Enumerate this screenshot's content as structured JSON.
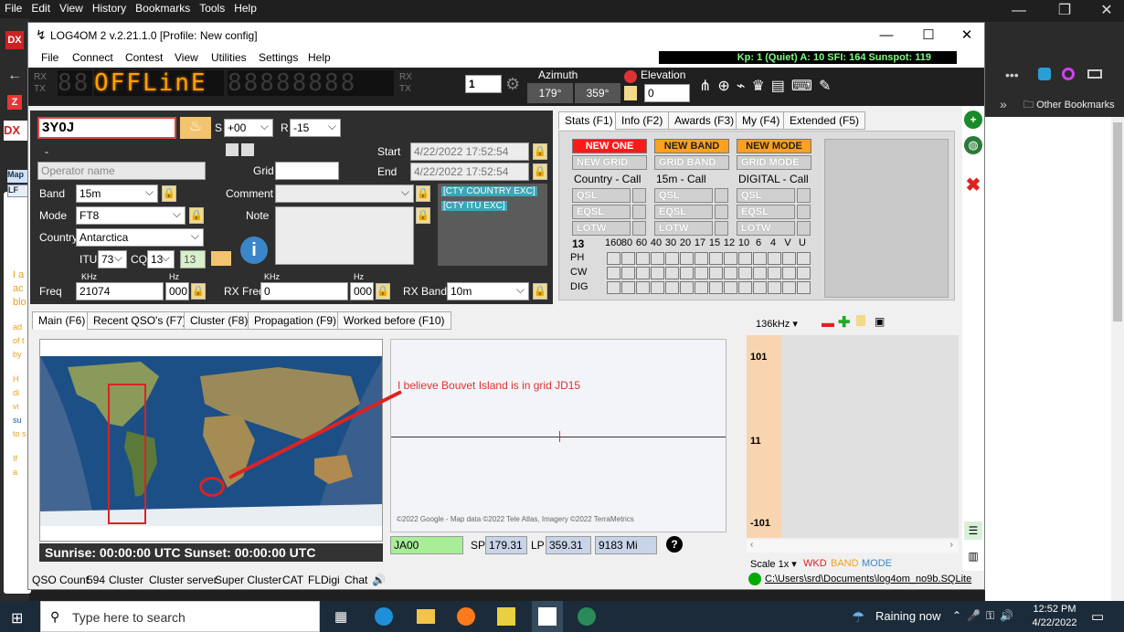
{
  "browser": {
    "menu": [
      "File",
      "Edit",
      "View",
      "History",
      "Bookmarks",
      "Tools",
      "Help"
    ],
    "other_bookmarks": "Other Bookmarks",
    "sidebar_bits": [
      "Map",
      "LF",
      "I a",
      "ac",
      "blo",
      "ad",
      "of t",
      "by",
      "H",
      "di",
      "vi",
      "su",
      "to s",
      "If",
      "a"
    ]
  },
  "app": {
    "title": "LOG4OM 2 v.2.21.1.0 [Profile: New config]",
    "menu": [
      "File",
      "Connect",
      "Contest",
      "View",
      "Utilities",
      "Settings",
      "Help"
    ],
    "kp_text": "Kp: 1 (Quiet)  A: 10  SFI: 164  Sunspot: 119",
    "display": {
      "left": "88",
      "offline": "OFFLinE",
      "right": "88888888"
    },
    "rx": "RX",
    "tx": "TX",
    "radio_num": "1",
    "azimuth": {
      "label": "Azimuth",
      "sp": "179°",
      "lp": "359°"
    },
    "elevation": {
      "label": "Elevation",
      "value": "0"
    },
    "qso": {
      "callsign": "3Y0J",
      "s_label": "S",
      "s_value": "+00",
      "r_label": "R",
      "r_value": "-15",
      "dash": "-",
      "operator_placeholder": "Operator name",
      "grid_label": "Grid",
      "grid_value": "",
      "start_label": "Start",
      "start_value": "4/22/2022 17:52:54",
      "end_label": "End",
      "end_value": "4/22/2022 17:52:54",
      "band_label": "Band",
      "band_value": "15m",
      "mode_label": "Mode",
      "mode_value": "FT8",
      "country_label": "Country",
      "country_value": "Antarctica",
      "itu_label": "ITU",
      "itu_value": "73",
      "cq_label": "CQ",
      "cq_value": "13",
      "cq_box": "13",
      "comment_label": "Comment",
      "note_label": "Note",
      "cty_msgs": [
        "[CTY COUNTRY EXC]",
        "[CTY ITU EXC]"
      ],
      "khz_label": "KHz",
      "hz_label": "Hz",
      "freq_label": "Freq",
      "freq_khz": "21074",
      "freq_hz": "000",
      "rxfreq_label": "RX Freq",
      "rxfreq_khz": "0",
      "rxfreq_hz": "000",
      "rxband_label": "RX Band",
      "rxband_value": "10m"
    },
    "stats_tabs": [
      "Stats (F1)",
      "Info (F2)",
      "Awards (F3)",
      "My (F4)",
      "Extended (F5)"
    ],
    "stats": {
      "columns": [
        {
          "badge": "NEW ONE",
          "badge_color": "#ff1a1a",
          "grid": "NEW GRID",
          "caption": "Country - Call"
        },
        {
          "badge": "NEW BAND",
          "badge_color": "#ff9f1a",
          "grid": "GRID BAND",
          "caption": "15m - Call"
        },
        {
          "badge": "NEW MODE",
          "badge_color": "#ff9f1a",
          "grid": "GRID MODE",
          "caption": "DIGITAL - Call"
        }
      ],
      "confirm_rows": [
        "QSL",
        "EQSL",
        "LOTW"
      ],
      "count": "13",
      "bands": [
        "160",
        "80",
        "60",
        "40",
        "30",
        "20",
        "17",
        "15",
        "12",
        "10",
        "6",
        "4",
        "V",
        "U"
      ],
      "modes": [
        "PH",
        "CW",
        "DIG"
      ]
    },
    "main_tabs": [
      "Main (F6)",
      "Recent QSO's (F7)",
      "Cluster (F8)",
      "Propagation (F9)",
      "Worked before (F10)"
    ],
    "sun_text": "Sunrise: 00:00:00 UTC   Sunset: 00:00:00 UTC",
    "annotation": "I believe Bouvet Island is in grid JD15",
    "map_copyright": "©2022 Google - Map data ©2022 Tele Atlas, Imagery ©2022 TerraMetrics",
    "locator": "JA00",
    "sp_label": "SP",
    "sp_value": "179.31",
    "lp_label": "LP",
    "lp_value": "359.31",
    "distance": "9183 Mi",
    "bandmap": {
      "band": "136kHz",
      "ticks": [
        "101",
        "11",
        "-101"
      ],
      "scale": "Scale 1x",
      "legend": {
        "wkd": "WKD",
        "band": "BAND",
        "mode": "MODE"
      }
    },
    "status": {
      "qso_count_label": "QSO Count",
      "qso_count": "594",
      "items": [
        "Cluster",
        "Cluster server",
        "Super Cluster",
        "CAT",
        "FLDigi",
        "Chat"
      ],
      "db_path": "C:\\Users\\srd\\Documents\\log4om_no9b.SQLite"
    }
  },
  "taskbar": {
    "search_placeholder": "Type here to search",
    "weather": "Raining now",
    "time": "12:52 PM",
    "date": "4/22/2022"
  }
}
